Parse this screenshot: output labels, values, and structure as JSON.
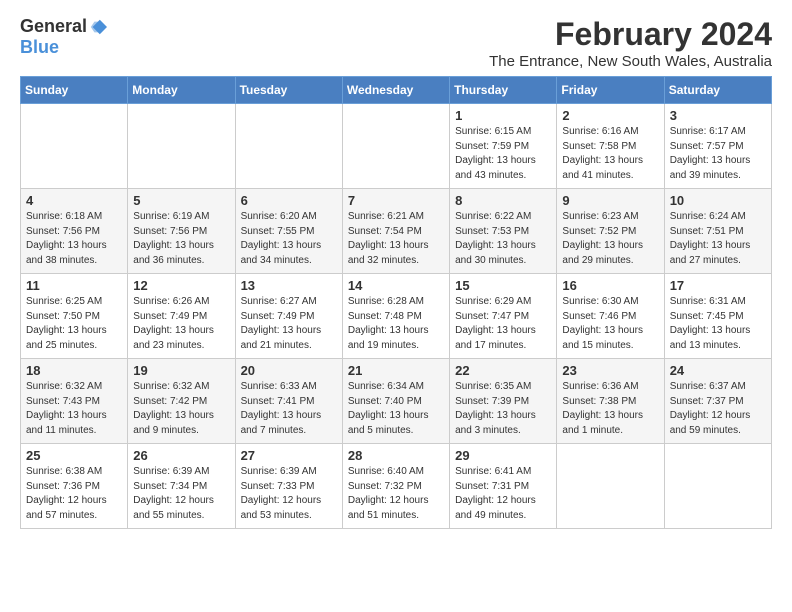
{
  "logo": {
    "general": "General",
    "blue": "Blue"
  },
  "header": {
    "month": "February 2024",
    "location": "The Entrance, New South Wales, Australia"
  },
  "days_of_week": [
    "Sunday",
    "Monday",
    "Tuesday",
    "Wednesday",
    "Thursday",
    "Friday",
    "Saturday"
  ],
  "weeks": [
    [
      {
        "day": "",
        "content": ""
      },
      {
        "day": "",
        "content": ""
      },
      {
        "day": "",
        "content": ""
      },
      {
        "day": "",
        "content": ""
      },
      {
        "day": "1",
        "content": "Sunrise: 6:15 AM\nSunset: 7:59 PM\nDaylight: 13 hours and 43 minutes."
      },
      {
        "day": "2",
        "content": "Sunrise: 6:16 AM\nSunset: 7:58 PM\nDaylight: 13 hours and 41 minutes."
      },
      {
        "day": "3",
        "content": "Sunrise: 6:17 AM\nSunset: 7:57 PM\nDaylight: 13 hours and 39 minutes."
      }
    ],
    [
      {
        "day": "4",
        "content": "Sunrise: 6:18 AM\nSunset: 7:56 PM\nDaylight: 13 hours and 38 minutes."
      },
      {
        "day": "5",
        "content": "Sunrise: 6:19 AM\nSunset: 7:56 PM\nDaylight: 13 hours and 36 minutes."
      },
      {
        "day": "6",
        "content": "Sunrise: 6:20 AM\nSunset: 7:55 PM\nDaylight: 13 hours and 34 minutes."
      },
      {
        "day": "7",
        "content": "Sunrise: 6:21 AM\nSunset: 7:54 PM\nDaylight: 13 hours and 32 minutes."
      },
      {
        "day": "8",
        "content": "Sunrise: 6:22 AM\nSunset: 7:53 PM\nDaylight: 13 hours and 30 minutes."
      },
      {
        "day": "9",
        "content": "Sunrise: 6:23 AM\nSunset: 7:52 PM\nDaylight: 13 hours and 29 minutes."
      },
      {
        "day": "10",
        "content": "Sunrise: 6:24 AM\nSunset: 7:51 PM\nDaylight: 13 hours and 27 minutes."
      }
    ],
    [
      {
        "day": "11",
        "content": "Sunrise: 6:25 AM\nSunset: 7:50 PM\nDaylight: 13 hours and 25 minutes."
      },
      {
        "day": "12",
        "content": "Sunrise: 6:26 AM\nSunset: 7:49 PM\nDaylight: 13 hours and 23 minutes."
      },
      {
        "day": "13",
        "content": "Sunrise: 6:27 AM\nSunset: 7:49 PM\nDaylight: 13 hours and 21 minutes."
      },
      {
        "day": "14",
        "content": "Sunrise: 6:28 AM\nSunset: 7:48 PM\nDaylight: 13 hours and 19 minutes."
      },
      {
        "day": "15",
        "content": "Sunrise: 6:29 AM\nSunset: 7:47 PM\nDaylight: 13 hours and 17 minutes."
      },
      {
        "day": "16",
        "content": "Sunrise: 6:30 AM\nSunset: 7:46 PM\nDaylight: 13 hours and 15 minutes."
      },
      {
        "day": "17",
        "content": "Sunrise: 6:31 AM\nSunset: 7:45 PM\nDaylight: 13 hours and 13 minutes."
      }
    ],
    [
      {
        "day": "18",
        "content": "Sunrise: 6:32 AM\nSunset: 7:43 PM\nDaylight: 13 hours and 11 minutes."
      },
      {
        "day": "19",
        "content": "Sunrise: 6:32 AM\nSunset: 7:42 PM\nDaylight: 13 hours and 9 minutes."
      },
      {
        "day": "20",
        "content": "Sunrise: 6:33 AM\nSunset: 7:41 PM\nDaylight: 13 hours and 7 minutes."
      },
      {
        "day": "21",
        "content": "Sunrise: 6:34 AM\nSunset: 7:40 PM\nDaylight: 13 hours and 5 minutes."
      },
      {
        "day": "22",
        "content": "Sunrise: 6:35 AM\nSunset: 7:39 PM\nDaylight: 13 hours and 3 minutes."
      },
      {
        "day": "23",
        "content": "Sunrise: 6:36 AM\nSunset: 7:38 PM\nDaylight: 13 hours and 1 minute."
      },
      {
        "day": "24",
        "content": "Sunrise: 6:37 AM\nSunset: 7:37 PM\nDaylight: 12 hours and 59 minutes."
      }
    ],
    [
      {
        "day": "25",
        "content": "Sunrise: 6:38 AM\nSunset: 7:36 PM\nDaylight: 12 hours and 57 minutes."
      },
      {
        "day": "26",
        "content": "Sunrise: 6:39 AM\nSunset: 7:34 PM\nDaylight: 12 hours and 55 minutes."
      },
      {
        "day": "27",
        "content": "Sunrise: 6:39 AM\nSunset: 7:33 PM\nDaylight: 12 hours and 53 minutes."
      },
      {
        "day": "28",
        "content": "Sunrise: 6:40 AM\nSunset: 7:32 PM\nDaylight: 12 hours and 51 minutes."
      },
      {
        "day": "29",
        "content": "Sunrise: 6:41 AM\nSunset: 7:31 PM\nDaylight: 12 hours and 49 minutes."
      },
      {
        "day": "",
        "content": ""
      },
      {
        "day": "",
        "content": ""
      }
    ]
  ]
}
